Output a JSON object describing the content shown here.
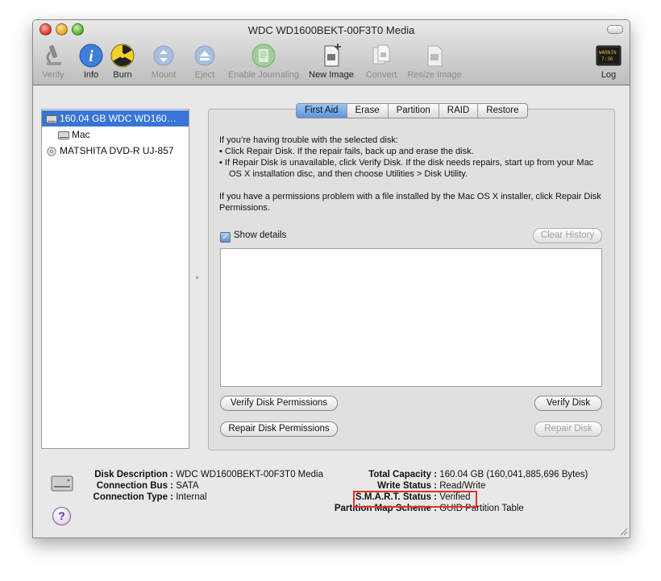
{
  "window": {
    "title": "WDC WD1600BEKT-00F3T0 Media"
  },
  "toolbar": {
    "verify": "Verify",
    "info": "Info",
    "burn": "Burn",
    "mount": "Mount",
    "eject": "Eject",
    "enable_journaling": "Enable Journaling",
    "new_image": "New Image",
    "convert": "Convert",
    "resize_image": "Resize Image",
    "log": "Log",
    "log_icon_text": "WARNIN 7:36"
  },
  "sidebar": {
    "items": [
      {
        "label": "160.04 GB WDC WD160…",
        "icon": "internal-disk-icon"
      },
      {
        "label": "Mac",
        "icon": "volume-icon"
      },
      {
        "label": "MATSHITA DVD-R UJ-857",
        "icon": "optical-disc-icon"
      }
    ]
  },
  "tabs": [
    "First Aid",
    "Erase",
    "Partition",
    "RAID",
    "Restore"
  ],
  "first_aid": {
    "intro": "If you’re having trouble with the selected disk:",
    "bullet1": "• Click Repair Disk. If the repair fails, back up and erase the disk.",
    "bullet2": "• If Repair Disk is unavailable, click Verify Disk. If the disk needs repairs, start up from your Mac OS X installation disc, and then choose Utilities > Disk Utility.",
    "permissions": "If you have a permissions problem with a file installed by the Mac OS X installer, click Repair Disk Permissions.",
    "show_details": "Show details",
    "clear_history": "Clear History",
    "verify_permissions": "Verify Disk Permissions",
    "verify_disk": "Verify Disk",
    "repair_permissions": "Repair Disk Permissions",
    "repair_disk": "Repair Disk"
  },
  "info": {
    "disk_description_label": "Disk Description :",
    "disk_description": "WDC WD1600BEKT-00F3T0 Media",
    "connection_bus_label": "Connection Bus :",
    "connection_bus": "SATA",
    "connection_type_label": "Connection Type :",
    "connection_type": "Internal",
    "total_capacity_label": "Total Capacity :",
    "total_capacity": "160.04 GB (160,041,885,696 Bytes)",
    "write_status_label": "Write Status :",
    "write_status": "Read/Write",
    "smart_status_label": "S.M.A.R.T. Status :",
    "smart_status": "Verified",
    "partition_map_label": "Partition Map Scheme :",
    "partition_map": "GUID Partition Table",
    "help": "?"
  },
  "colors": {
    "selection": "#3875d7",
    "highlight_box": "#e0322c"
  }
}
